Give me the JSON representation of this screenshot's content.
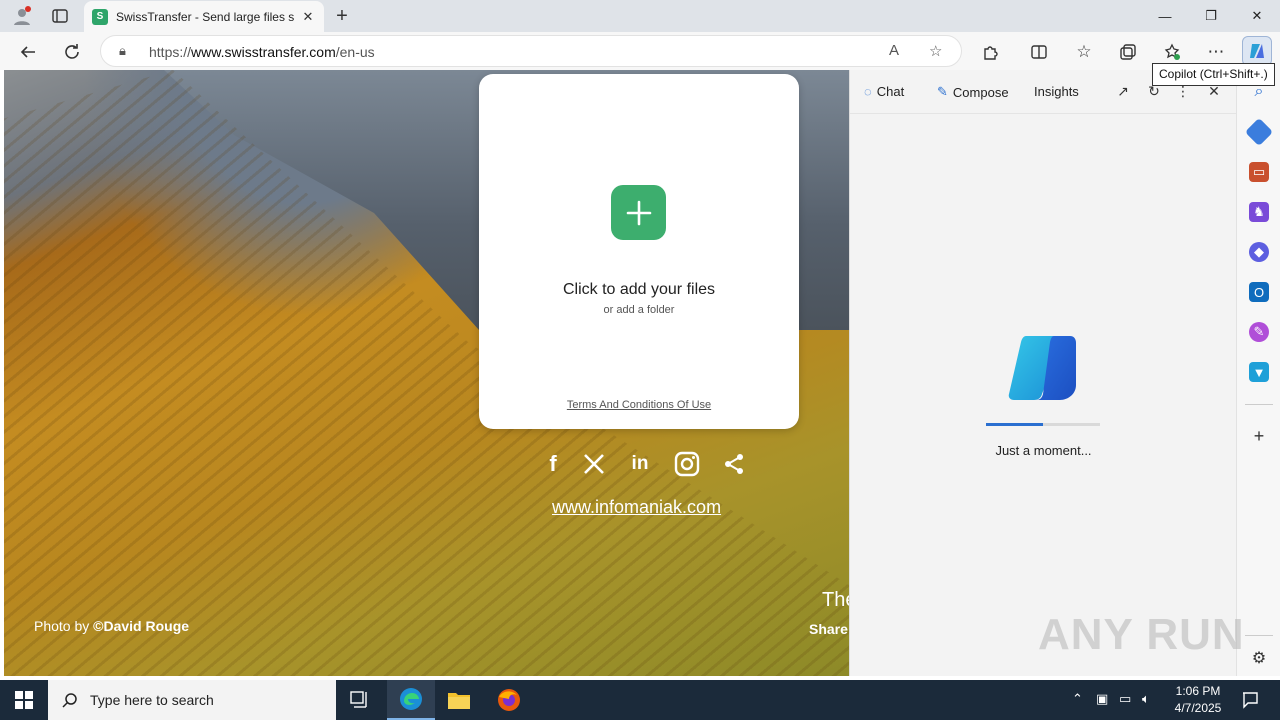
{
  "browser": {
    "tab_title": "SwissTransfer - Send large files se",
    "favicon_letter": "S",
    "url_prefix": "https://",
    "url_host": "www.swisstransfer.com",
    "url_path": "/en-us",
    "tooltip": "Copilot (Ctrl+Shift+.)"
  },
  "page": {
    "card_title": "Click to add your files",
    "card_subtitle": "or add a folder",
    "terms": "Terms And Conditions Of Use",
    "website": "www.infomaniak.com",
    "photo_prefix": "Photo by ",
    "photo_author": "©David Rouge",
    "tagline_1": "The",
    "tagline_2": "Share"
  },
  "copilot": {
    "tabs": [
      "Chat",
      "Compose",
      "Insights"
    ],
    "status": "Just a moment...",
    "progress": 0.5
  },
  "taskbar": {
    "search_placeholder": "Type here to search",
    "time": "1:06 PM",
    "date": "4/7/2025"
  },
  "watermark": "ANY RUN",
  "colors": {
    "accent_green": "#3dae6e",
    "copilot_blue": "#2a6fd0"
  }
}
